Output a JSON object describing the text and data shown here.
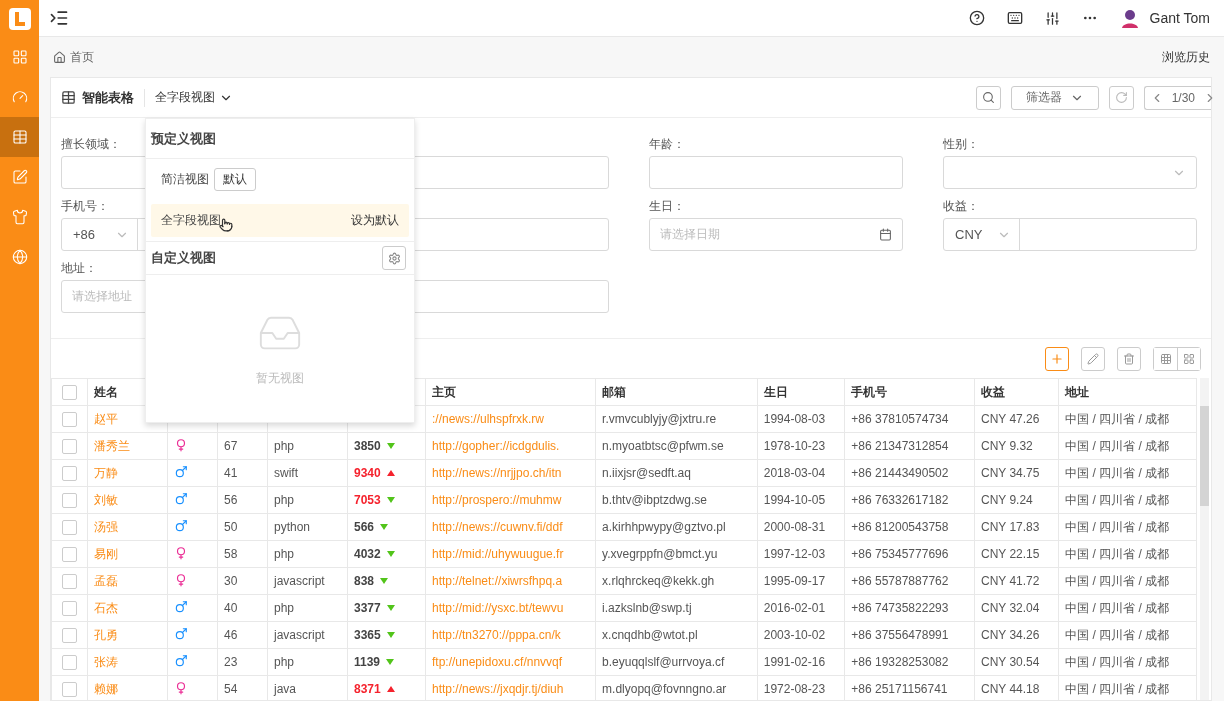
{
  "sidebar": {
    "items": [
      {
        "kind": "dashboard",
        "selected": false
      },
      {
        "kind": "gauge",
        "selected": false
      },
      {
        "kind": "table",
        "selected": true
      },
      {
        "kind": "edit",
        "selected": false
      },
      {
        "kind": "shirt",
        "selected": false
      },
      {
        "kind": "globe",
        "selected": false
      }
    ]
  },
  "header": {
    "user": "Gant Tom"
  },
  "breadcrumb": "首页",
  "history_link": "浏览历史",
  "card": {
    "title": "智能表格",
    "view": "全字段视图",
    "filter": "筛选器",
    "page": "1/30"
  },
  "form": [
    [
      {
        "label": "擅长领域：",
        "kind": "input"
      },
      {
        "kind": "input"
      },
      {
        "label": "年龄：",
        "kind": "input"
      },
      {
        "label": "性别：",
        "kind": "select"
      }
    ],
    [
      {
        "label": "手机号：",
        "kind": "prefix",
        "prefix": "+86"
      },
      {
        "kind": "input"
      },
      {
        "label": "生日：",
        "kind": "date",
        "placeholder": "请选择日期"
      },
      {
        "label": "收益：",
        "kind": "prefix",
        "prefix": "CNY"
      }
    ],
    [
      {
        "label": "地址：",
        "kind": "input",
        "placeholder": "请选择地址"
      },
      {
        "kind": "input"
      }
    ]
  ],
  "dropdown": {
    "predefined_title": "预定义视图",
    "items": [
      {
        "label": "简洁视图",
        "badge": "默认",
        "hovered": false
      },
      {
        "label": "全字段视图",
        "action": "设为默认",
        "hovered": true
      }
    ],
    "custom_title": "自定义视图",
    "empty_text": "暂无视图"
  },
  "table": {
    "all_checked": false,
    "columns": [
      "姓名",
      null,
      null,
      null,
      null,
      "主页",
      "邮箱",
      "生日",
      "手机号",
      "收益",
      "地址"
    ],
    "rows": [
      {
        "checked": false,
        "name": "赵平",
        "homepage": "://news://ulhspfrxk.rw",
        "email": "r.vmvcublyjy@jxtru.re",
        "birthday": "1994-08-03",
        "phone": "+86 37810574734",
        "income": "CNY 47.26",
        "address": "中国 / 四川省 / 成都"
      },
      {
        "checked": false,
        "name": "潘秀兰",
        "female": true,
        "age": "67",
        "skill": "php",
        "score": "3850",
        "rising": false,
        "high": false,
        "homepage": "http://gopher://icdgdulis.",
        "email": "n.myoatbtsc@pfwm.se",
        "birthday": "1978-10-23",
        "phone": "+86 21347312854",
        "income": "CNY 9.32",
        "address": "中国 / 四川省 / 成都"
      },
      {
        "checked": false,
        "name": "万静",
        "female": false,
        "age": "41",
        "skill": "swift",
        "score": "9340",
        "rising": true,
        "high": true,
        "homepage": "http://news://nrjjpo.ch/itn",
        "email": "n.iixjsr@sedft.aq",
        "birthday": "2018-03-04",
        "phone": "+86 21443490502",
        "income": "CNY 34.75",
        "address": "中国 / 四川省 / 成都"
      },
      {
        "checked": false,
        "name": "刘敏",
        "female": false,
        "age": "56",
        "skill": "php",
        "score": "7053",
        "rising": false,
        "high": true,
        "homepage": "http://prospero://muhmw",
        "email": "b.thtv@ibptzdwg.se",
        "birthday": "1994-10-05",
        "phone": "+86 76332617182",
        "income": "CNY 9.24",
        "address": "中国 / 四川省 / 成都"
      },
      {
        "checked": false,
        "name": "汤强",
        "female": false,
        "age": "50",
        "skill": "python",
        "score": "566",
        "rising": false,
        "high": false,
        "homepage": "http://news://cuwnv.fi/ddf",
        "email": "a.kirhhpwypy@gztvo.pl",
        "birthday": "2000-08-31",
        "phone": "+86 81200543758",
        "income": "CNY 17.83",
        "address": "中国 / 四川省 / 成都"
      },
      {
        "checked": false,
        "name": "易刚",
        "female": true,
        "age": "58",
        "skill": "php",
        "score": "4032",
        "rising": false,
        "high": false,
        "homepage": "http://mid://uhywuugue.fr",
        "email": "y.xvegrppfn@bmct.yu",
        "birthday": "1997-12-03",
        "phone": "+86 75345777696",
        "income": "CNY 22.15",
        "address": "中国 / 四川省 / 成都"
      },
      {
        "checked": false,
        "name": "孟磊",
        "female": true,
        "age": "30",
        "skill": "javascript",
        "score": "838",
        "rising": false,
        "high": false,
        "homepage": "http://telnet://xiwrsfhpq.a",
        "email": "x.rlqhrckeq@kekk.gh",
        "birthday": "1995-09-17",
        "phone": "+86 55787887762",
        "income": "CNY 41.72",
        "address": "中国 / 四川省 / 成都"
      },
      {
        "checked": false,
        "name": "石杰",
        "female": false,
        "age": "40",
        "skill": "php",
        "score": "3377",
        "rising": false,
        "high": false,
        "homepage": "http://mid://ysxc.bt/tewvu",
        "email": "i.azkslnb@swp.tj",
        "birthday": "2016-02-01",
        "phone": "+86 74735822293",
        "income": "CNY 32.04",
        "address": "中国 / 四川省 / 成都"
      },
      {
        "checked": false,
        "name": "孔勇",
        "female": false,
        "age": "46",
        "skill": "javascript",
        "score": "3365",
        "rising": false,
        "high": false,
        "homepage": "http://tn3270://pppa.cn/k",
        "email": "x.cnqdhb@wtot.pl",
        "birthday": "2003-10-02",
        "phone": "+86 37556478991",
        "income": "CNY 34.26",
        "address": "中国 / 四川省 / 成都"
      },
      {
        "checked": false,
        "name": "张涛",
        "female": false,
        "age": "23",
        "skill": "php",
        "score": "1139",
        "rising": false,
        "high": false,
        "homepage": "ftp://unepidoxu.cf/nnvvqf",
        "email": "b.eyuqqlslf@urrvoya.cf",
        "birthday": "1991-02-16",
        "phone": "+86 19328253082",
        "income": "CNY 30.54",
        "address": "中国 / 四川省 / 成都"
      },
      {
        "checked": false,
        "name": "赖娜",
        "female": true,
        "age": "54",
        "skill": "java",
        "score": "8371",
        "rising": true,
        "high": true,
        "homepage": "http://news://jxqdjr.tj/diuh",
        "email": "m.dlyopq@fovnngno.ar",
        "birthday": "1972-08-23",
        "phone": "+86 25171156741",
        "income": "CNY 44.18",
        "address": "中国 / 四川省 / 成都"
      }
    ]
  }
}
